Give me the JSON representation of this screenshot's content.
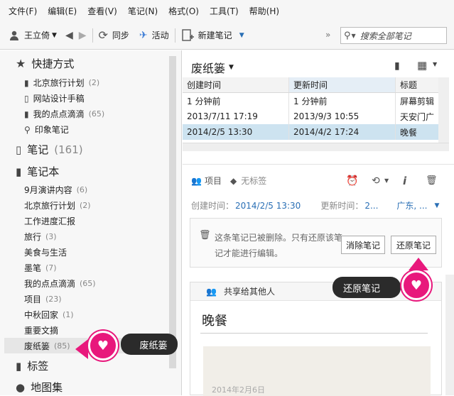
{
  "menu": [
    "文件(F)",
    "编辑(E)",
    "查看(V)",
    "笔记(N)",
    "格式(O)",
    "工具(T)",
    "帮助(H)"
  ],
  "toolbar": {
    "user": "王立倚",
    "sync": "同步",
    "activity": "活动",
    "new_note": "新建笔记",
    "search_placeholder": "搜索全部笔记"
  },
  "sidebar": {
    "shortcuts_title": "快捷方式",
    "shortcuts": [
      {
        "label": "北京旅行计划",
        "count": "(2)"
      },
      {
        "label": "网站设计手稿",
        "count": ""
      },
      {
        "label": "我的点点滴滴",
        "count": "(65)"
      },
      {
        "label": "印象笔记",
        "count": ""
      }
    ],
    "notes_title": "笔记",
    "notes_count": "(161)",
    "notebooks_title": "笔记本",
    "notebooks": [
      {
        "label": "9月演讲内容",
        "count": "(6)"
      },
      {
        "label": "北京旅行计划",
        "count": "(2)"
      },
      {
        "label": "工作进度汇报",
        "count": ""
      },
      {
        "label": "旅行",
        "count": "(3)"
      },
      {
        "label": "美食与生活",
        "count": ""
      },
      {
        "label": "墨笔",
        "count": "(7)"
      },
      {
        "label": "我的点点滴滴",
        "count": "(65)"
      },
      {
        "label": "项目",
        "count": "(23)"
      },
      {
        "label": "中秋回家",
        "count": "(1)"
      },
      {
        "label": "重要文摘",
        "count": ""
      },
      {
        "label": "废纸篓",
        "count": "(85)"
      }
    ],
    "tags_title": "标签",
    "atlas_title": "地图集",
    "trash_callout": "废纸篓"
  },
  "main": {
    "notebook_title": "废纸篓",
    "columns": [
      "创建时间",
      "更新时间",
      "标题"
    ],
    "rows": [
      [
        "1 分钟前",
        "1 分钟前",
        "屏幕剪辑"
      ],
      [
        "2013/7/11 17:19",
        "2013/9/3 10:55",
        "天安门广"
      ],
      [
        "2014/2/5 13:30",
        "2014/4/2 17:24",
        "晚餐"
      ]
    ],
    "selected_row": 2,
    "project_label": "项目",
    "no_tag": "无标签",
    "created_label": "创建时间：",
    "created_value": "2014/2/5 13:30",
    "updated_label": "更新时间：",
    "updated_value": "2...",
    "location_value": "广东, ...",
    "notice_text": "这条笔记已被删除。只有还原该笔记才能进行编辑。",
    "clear_button": "消除笔记",
    "restore_button": "还原笔记",
    "restore_callout": "还原笔记",
    "shared_label": "共享给其他人",
    "note_title": "晚餐",
    "note_date": "2014年2月6日"
  }
}
